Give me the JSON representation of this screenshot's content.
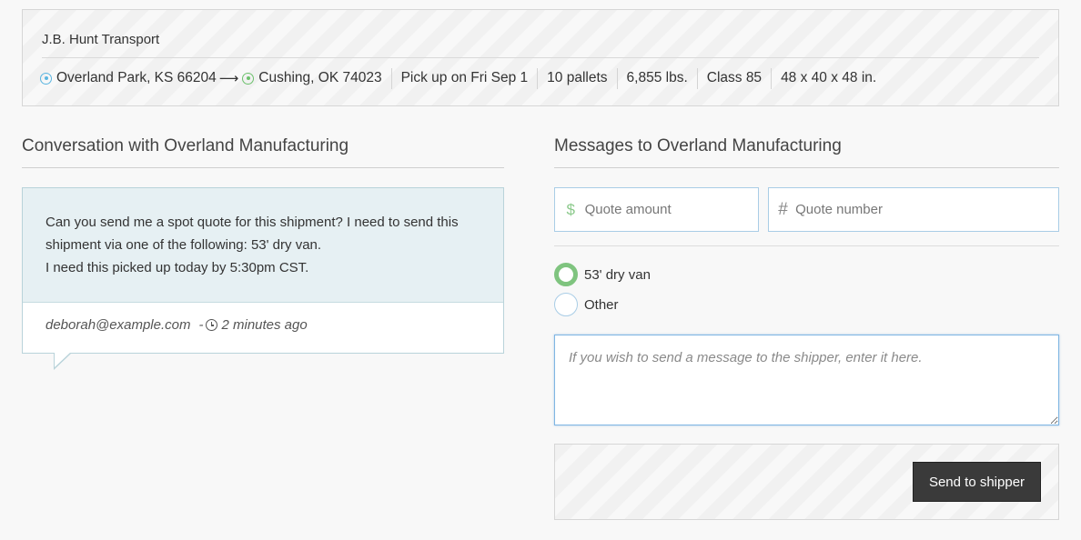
{
  "shipment": {
    "carrier": "J.B. Hunt Transport",
    "origin": "Overland Park, KS 66204",
    "arrow": "⟶",
    "destination": "Cushing, OK 74023",
    "pickup": "Pick up on Fri Sep 1",
    "pallets": "10 pallets",
    "weight": "6,855 lbs.",
    "freight_class": "Class 85",
    "dimensions": "48 x 40 x 48 in."
  },
  "conversation": {
    "title": "Conversation with Overland Manufacturing",
    "message_line1": "Can you send me a spot quote for this shipment? I need to send this shipment via one of the following: 53' dry van.",
    "message_line2": "I need this picked up today by 5:30pm CST.",
    "sender": "deborah@example.com",
    "separator": "-",
    "time_ago": "2 minutes ago"
  },
  "messages": {
    "title": "Messages to Overland Manufacturing",
    "quote_amount_placeholder": "Quote amount",
    "quote_number_placeholder": "Quote number",
    "amount_icon": "dollar-icon",
    "number_icon": "hash-icon",
    "equipment_options": [
      {
        "label": "53' dry van",
        "selected": true
      },
      {
        "label": "Other",
        "selected": false
      }
    ],
    "message_placeholder": "If you wish to send a message to the shipper, enter it here.",
    "send_label": "Send to shipper"
  },
  "colors": {
    "origin_pin": "#5bb5e0",
    "destination_pin": "#6cc06c",
    "selected_radio": "#7fc47f",
    "bubble_bg": "#e6f0f3",
    "send_button": "#3a3a3a"
  }
}
